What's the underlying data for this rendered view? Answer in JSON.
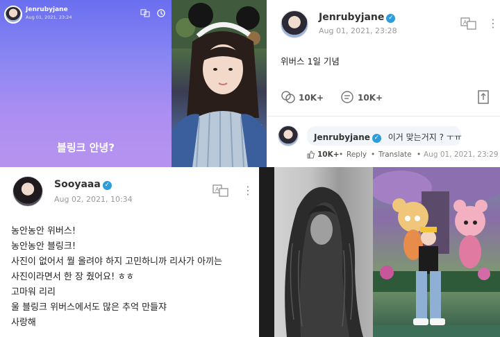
{
  "story": {
    "username": "Jenrubyjane",
    "timestamp": "Aug 01, 2021, 23:24",
    "text": "블링크 안녕?"
  },
  "post1": {
    "username": "Jenrubyjane",
    "timestamp": "Aug 01, 2021, 23:28",
    "body": "위버스 1일 기념",
    "likes": "10K+",
    "comments": "10K+",
    "comment": {
      "username": "Jenrubyjane",
      "text": "이거 맞는거지 ? ㅜㅠ",
      "likes": "10K+",
      "reply_label": "Reply",
      "translate_label": "Translate",
      "timestamp": "Aug 01, 2021, 23:29"
    }
  },
  "post2": {
    "username": "Sooyaaa",
    "timestamp": "Aug 02, 2021, 10:34",
    "lines": [
      "농안농안 위버스!",
      "농안농안 블링크!",
      "사진이 없어서 뭘 올려야 하지 고민하니까 리사가 아끼는",
      "사진이라면서 한 장 줬어요! ㅎㅎ",
      "고마워 리리",
      "울 블링크 위버스에서도 많은 추억 만들쟈",
      "사랑해"
    ]
  },
  "icons": {
    "translate": "translate-icon",
    "history": "history-icon",
    "more": "more-vertical-icon",
    "like": "like-icon",
    "comment": "comment-icon",
    "share": "share-icon",
    "verified": "verified-badge-icon"
  },
  "colors": {
    "verified_blue": "#2d9cdb",
    "story_gradient_top": "#6a6ff0",
    "story_gradient_bottom": "#b693ef"
  }
}
